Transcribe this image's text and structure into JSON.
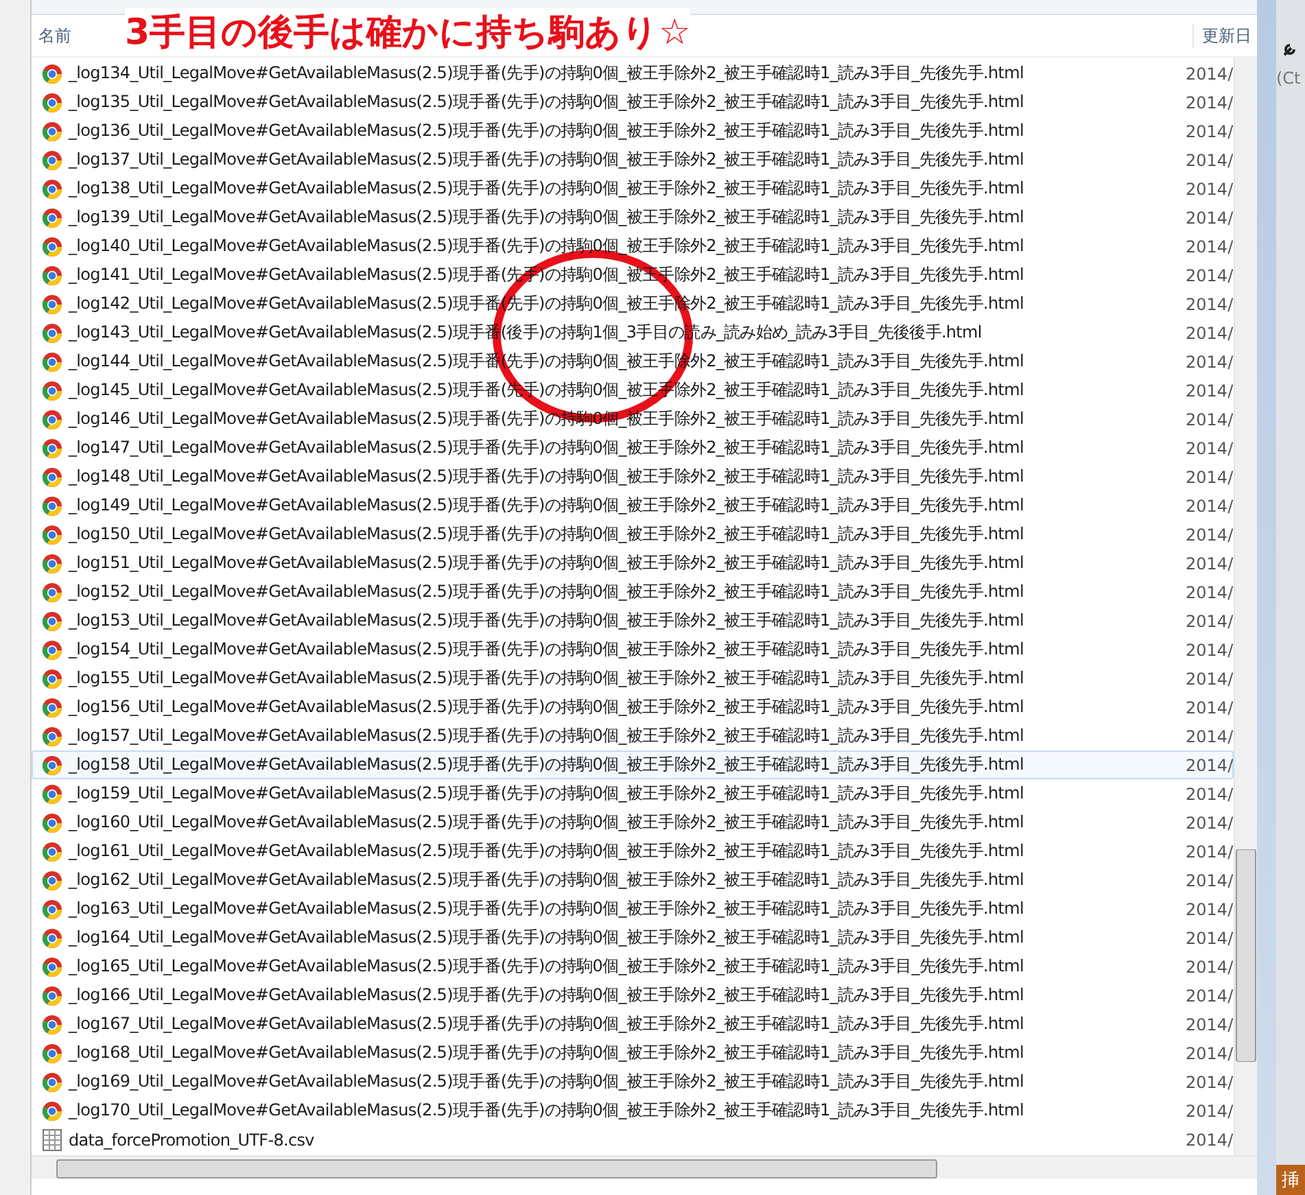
{
  "annotation": {
    "text": "3手目の後手は確かに持ち駒あり☆"
  },
  "columns": [
    {
      "label": "名前"
    },
    {
      "label": "更新日"
    }
  ],
  "files": [
    {
      "name": "_log134_Util_LegalMove#GetAvailableMasus(2.5)現手番(先手)の持駒0個_被王手除外2_被王手確認時1_読み3手目_先後先手.html",
      "date": "2014/",
      "kind": "html",
      "hovered": false
    },
    {
      "name": "_log135_Util_LegalMove#GetAvailableMasus(2.5)現手番(先手)の持駒0個_被王手除外2_被王手確認時1_読み3手目_先後先手.html",
      "date": "2014/",
      "kind": "html",
      "hovered": false
    },
    {
      "name": "_log136_Util_LegalMove#GetAvailableMasus(2.5)現手番(先手)の持駒0個_被王手除外2_被王手確認時1_読み3手目_先後先手.html",
      "date": "2014/",
      "kind": "html",
      "hovered": false
    },
    {
      "name": "_log137_Util_LegalMove#GetAvailableMasus(2.5)現手番(先手)の持駒0個_被王手除外2_被王手確認時1_読み3手目_先後先手.html",
      "date": "2014/",
      "kind": "html",
      "hovered": false
    },
    {
      "name": "_log138_Util_LegalMove#GetAvailableMasus(2.5)現手番(先手)の持駒0個_被王手除外2_被王手確認時1_読み3手目_先後先手.html",
      "date": "2014/",
      "kind": "html",
      "hovered": false
    },
    {
      "name": "_log139_Util_LegalMove#GetAvailableMasus(2.5)現手番(先手)の持駒0個_被王手除外2_被王手確認時1_読み3手目_先後先手.html",
      "date": "2014/",
      "kind": "html",
      "hovered": false
    },
    {
      "name": "_log140_Util_LegalMove#GetAvailableMasus(2.5)現手番(先手)の持駒0個_被王手除外2_被王手確認時1_読み3手目_先後先手.html",
      "date": "2014/",
      "kind": "html",
      "hovered": false
    },
    {
      "name": "_log141_Util_LegalMove#GetAvailableMasus(2.5)現手番(先手)の持駒0個_被王手除外2_被王手確認時1_読み3手目_先後先手.html",
      "date": "2014/",
      "kind": "html",
      "hovered": false
    },
    {
      "name": "_log142_Util_LegalMove#GetAvailableMasus(2.5)現手番(先手)の持駒0個_被王手除外2_被王手確認時1_読み3手目_先後先手.html",
      "date": "2014/",
      "kind": "html",
      "hovered": false
    },
    {
      "name": "_log143_Util_LegalMove#GetAvailableMasus(2.5)現手番(後手)の持駒1個_3手目の読み_読み始め_読み3手目_先後後手.html",
      "date": "2014/",
      "kind": "html",
      "hovered": false
    },
    {
      "name": "_log144_Util_LegalMove#GetAvailableMasus(2.5)現手番(先手)の持駒0個_被王手除外2_被王手確認時1_読み3手目_先後先手.html",
      "date": "2014/",
      "kind": "html",
      "hovered": false
    },
    {
      "name": "_log145_Util_LegalMove#GetAvailableMasus(2.5)現手番(先手)の持駒0個_被王手除外2_被王手確認時1_読み3手目_先後先手.html",
      "date": "2014/",
      "kind": "html",
      "hovered": false
    },
    {
      "name": "_log146_Util_LegalMove#GetAvailableMasus(2.5)現手番(先手)の持駒0個_被王手除外2_被王手確認時1_読み3手目_先後先手.html",
      "date": "2014/",
      "kind": "html",
      "hovered": false
    },
    {
      "name": "_log147_Util_LegalMove#GetAvailableMasus(2.5)現手番(先手)の持駒0個_被王手除外2_被王手確認時1_読み3手目_先後先手.html",
      "date": "2014/",
      "kind": "html",
      "hovered": false
    },
    {
      "name": "_log148_Util_LegalMove#GetAvailableMasus(2.5)現手番(先手)の持駒0個_被王手除外2_被王手確認時1_読み3手目_先後先手.html",
      "date": "2014/",
      "kind": "html",
      "hovered": false
    },
    {
      "name": "_log149_Util_LegalMove#GetAvailableMasus(2.5)現手番(先手)の持駒0個_被王手除外2_被王手確認時1_読み3手目_先後先手.html",
      "date": "2014/",
      "kind": "html",
      "hovered": false
    },
    {
      "name": "_log150_Util_LegalMove#GetAvailableMasus(2.5)現手番(先手)の持駒0個_被王手除外2_被王手確認時1_読み3手目_先後先手.html",
      "date": "2014/",
      "kind": "html",
      "hovered": false
    },
    {
      "name": "_log151_Util_LegalMove#GetAvailableMasus(2.5)現手番(先手)の持駒0個_被王手除外2_被王手確認時1_読み3手目_先後先手.html",
      "date": "2014/",
      "kind": "html",
      "hovered": false
    },
    {
      "name": "_log152_Util_LegalMove#GetAvailableMasus(2.5)現手番(先手)の持駒0個_被王手除外2_被王手確認時1_読み3手目_先後先手.html",
      "date": "2014/",
      "kind": "html",
      "hovered": false
    },
    {
      "name": "_log153_Util_LegalMove#GetAvailableMasus(2.5)現手番(先手)の持駒0個_被王手除外2_被王手確認時1_読み3手目_先後先手.html",
      "date": "2014/",
      "kind": "html",
      "hovered": false
    },
    {
      "name": "_log154_Util_LegalMove#GetAvailableMasus(2.5)現手番(先手)の持駒0個_被王手除外2_被王手確認時1_読み3手目_先後先手.html",
      "date": "2014/",
      "kind": "html",
      "hovered": false
    },
    {
      "name": "_log155_Util_LegalMove#GetAvailableMasus(2.5)現手番(先手)の持駒0個_被王手除外2_被王手確認時1_読み3手目_先後先手.html",
      "date": "2014/",
      "kind": "html",
      "hovered": false
    },
    {
      "name": "_log156_Util_LegalMove#GetAvailableMasus(2.5)現手番(先手)の持駒0個_被王手除外2_被王手確認時1_読み3手目_先後先手.html",
      "date": "2014/",
      "kind": "html",
      "hovered": false
    },
    {
      "name": "_log157_Util_LegalMove#GetAvailableMasus(2.5)現手番(先手)の持駒0個_被王手除外2_被王手確認時1_読み3手目_先後先手.html",
      "date": "2014/",
      "kind": "html",
      "hovered": false
    },
    {
      "name": "_log158_Util_LegalMove#GetAvailableMasus(2.5)現手番(先手)の持駒0個_被王手除外2_被王手確認時1_読み3手目_先後先手.html",
      "date": "2014/",
      "kind": "html",
      "hovered": true
    },
    {
      "name": "_log159_Util_LegalMove#GetAvailableMasus(2.5)現手番(先手)の持駒0個_被王手除外2_被王手確認時1_読み3手目_先後先手.html",
      "date": "2014/",
      "kind": "html",
      "hovered": false
    },
    {
      "name": "_log160_Util_LegalMove#GetAvailableMasus(2.5)現手番(先手)の持駒0個_被王手除外2_被王手確認時1_読み3手目_先後先手.html",
      "date": "2014/",
      "kind": "html",
      "hovered": false
    },
    {
      "name": "_log161_Util_LegalMove#GetAvailableMasus(2.5)現手番(先手)の持駒0個_被王手除外2_被王手確認時1_読み3手目_先後先手.html",
      "date": "2014/",
      "kind": "html",
      "hovered": false
    },
    {
      "name": "_log162_Util_LegalMove#GetAvailableMasus(2.5)現手番(先手)の持駒0個_被王手除外2_被王手確認時1_読み3手目_先後先手.html",
      "date": "2014/",
      "kind": "html",
      "hovered": false
    },
    {
      "name": "_log163_Util_LegalMove#GetAvailableMasus(2.5)現手番(先手)の持駒0個_被王手除外2_被王手確認時1_読み3手目_先後先手.html",
      "date": "2014/",
      "kind": "html",
      "hovered": false
    },
    {
      "name": "_log164_Util_LegalMove#GetAvailableMasus(2.5)現手番(先手)の持駒0個_被王手除外2_被王手確認時1_読み3手目_先後先手.html",
      "date": "2014/",
      "kind": "html",
      "hovered": false
    },
    {
      "name": "_log165_Util_LegalMove#GetAvailableMasus(2.5)現手番(先手)の持駒0個_被王手除外2_被王手確認時1_読み3手目_先後先手.html",
      "date": "2014/",
      "kind": "html",
      "hovered": false
    },
    {
      "name": "_log166_Util_LegalMove#GetAvailableMasus(2.5)現手番(先手)の持駒0個_被王手除外2_被王手確認時1_読み3手目_先後先手.html",
      "date": "2014/",
      "kind": "html",
      "hovered": false
    },
    {
      "name": "_log167_Util_LegalMove#GetAvailableMasus(2.5)現手番(先手)の持駒0個_被王手除外2_被王手確認時1_読み3手目_先後先手.html",
      "date": "2014/",
      "kind": "html",
      "hovered": false
    },
    {
      "name": "_log168_Util_LegalMove#GetAvailableMasus(2.5)現手番(先手)の持駒0個_被王手除外2_被王手確認時1_読み3手目_先後先手.html",
      "date": "2014/",
      "kind": "html",
      "hovered": false
    },
    {
      "name": "_log169_Util_LegalMove#GetAvailableMasus(2.5)現手番(先手)の持駒0個_被王手除外2_被王手確認時1_読み3手目_先後先手.html",
      "date": "2014/",
      "kind": "html",
      "hovered": false
    },
    {
      "name": "_log170_Util_LegalMove#GetAvailableMasus(2.5)現手番(先手)の持駒0個_被王手除外2_被王手確認時1_読み3手目_先後先手.html",
      "date": "2014/",
      "kind": "html",
      "hovered": false
    },
    {
      "name": "data_forcePromotion_UTF-8.csv",
      "date": "2014/",
      "kind": "csv",
      "hovered": false
    }
  ],
  "outside": {
    "hint": "(Ct",
    "tab": "挿"
  }
}
